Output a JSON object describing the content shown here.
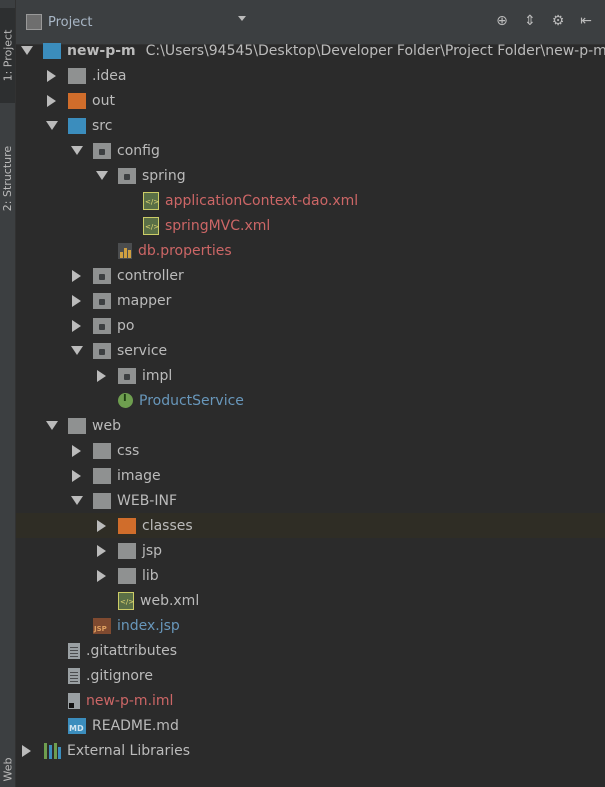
{
  "side_tabs": {
    "project": "1: Project",
    "structure": "2: Structure",
    "web": "Web"
  },
  "header": {
    "view_label": "Project"
  },
  "tree": [
    {
      "label": "new-p-m",
      "path": "C:\\Users\\94545\\Desktop\\Developer Folder\\Project Folder\\new-p-m"
    },
    {
      "label": ".idea"
    },
    {
      "label": "out"
    },
    {
      "label": "src"
    },
    {
      "label": "config"
    },
    {
      "label": "spring"
    },
    {
      "label": "applicationContext-dao.xml"
    },
    {
      "label": "springMVC.xml"
    },
    {
      "label": "db.properties"
    },
    {
      "label": "controller"
    },
    {
      "label": "mapper"
    },
    {
      "label": "po"
    },
    {
      "label": "service"
    },
    {
      "label": "impl"
    },
    {
      "label": "ProductService"
    },
    {
      "label": "web"
    },
    {
      "label": "css"
    },
    {
      "label": "image"
    },
    {
      "label": "WEB-INF"
    },
    {
      "label": "classes"
    },
    {
      "label": "jsp"
    },
    {
      "label": "lib"
    },
    {
      "label": "web.xml"
    },
    {
      "label": "index.jsp"
    },
    {
      "label": ".gitattributes"
    },
    {
      "label": ".gitignore"
    },
    {
      "label": "new-p-m.iml"
    },
    {
      "label": "README.md"
    },
    {
      "label": "External Libraries"
    }
  ],
  "colors": {
    "background": "#2b2b2b",
    "panel": "#3c3f41",
    "text": "#bbbbbb",
    "error_red": "#cc6666",
    "link_blue": "#6897bb",
    "source_folder_blue": "#3b8dbd",
    "excluded_orange": "#d06d2b"
  }
}
